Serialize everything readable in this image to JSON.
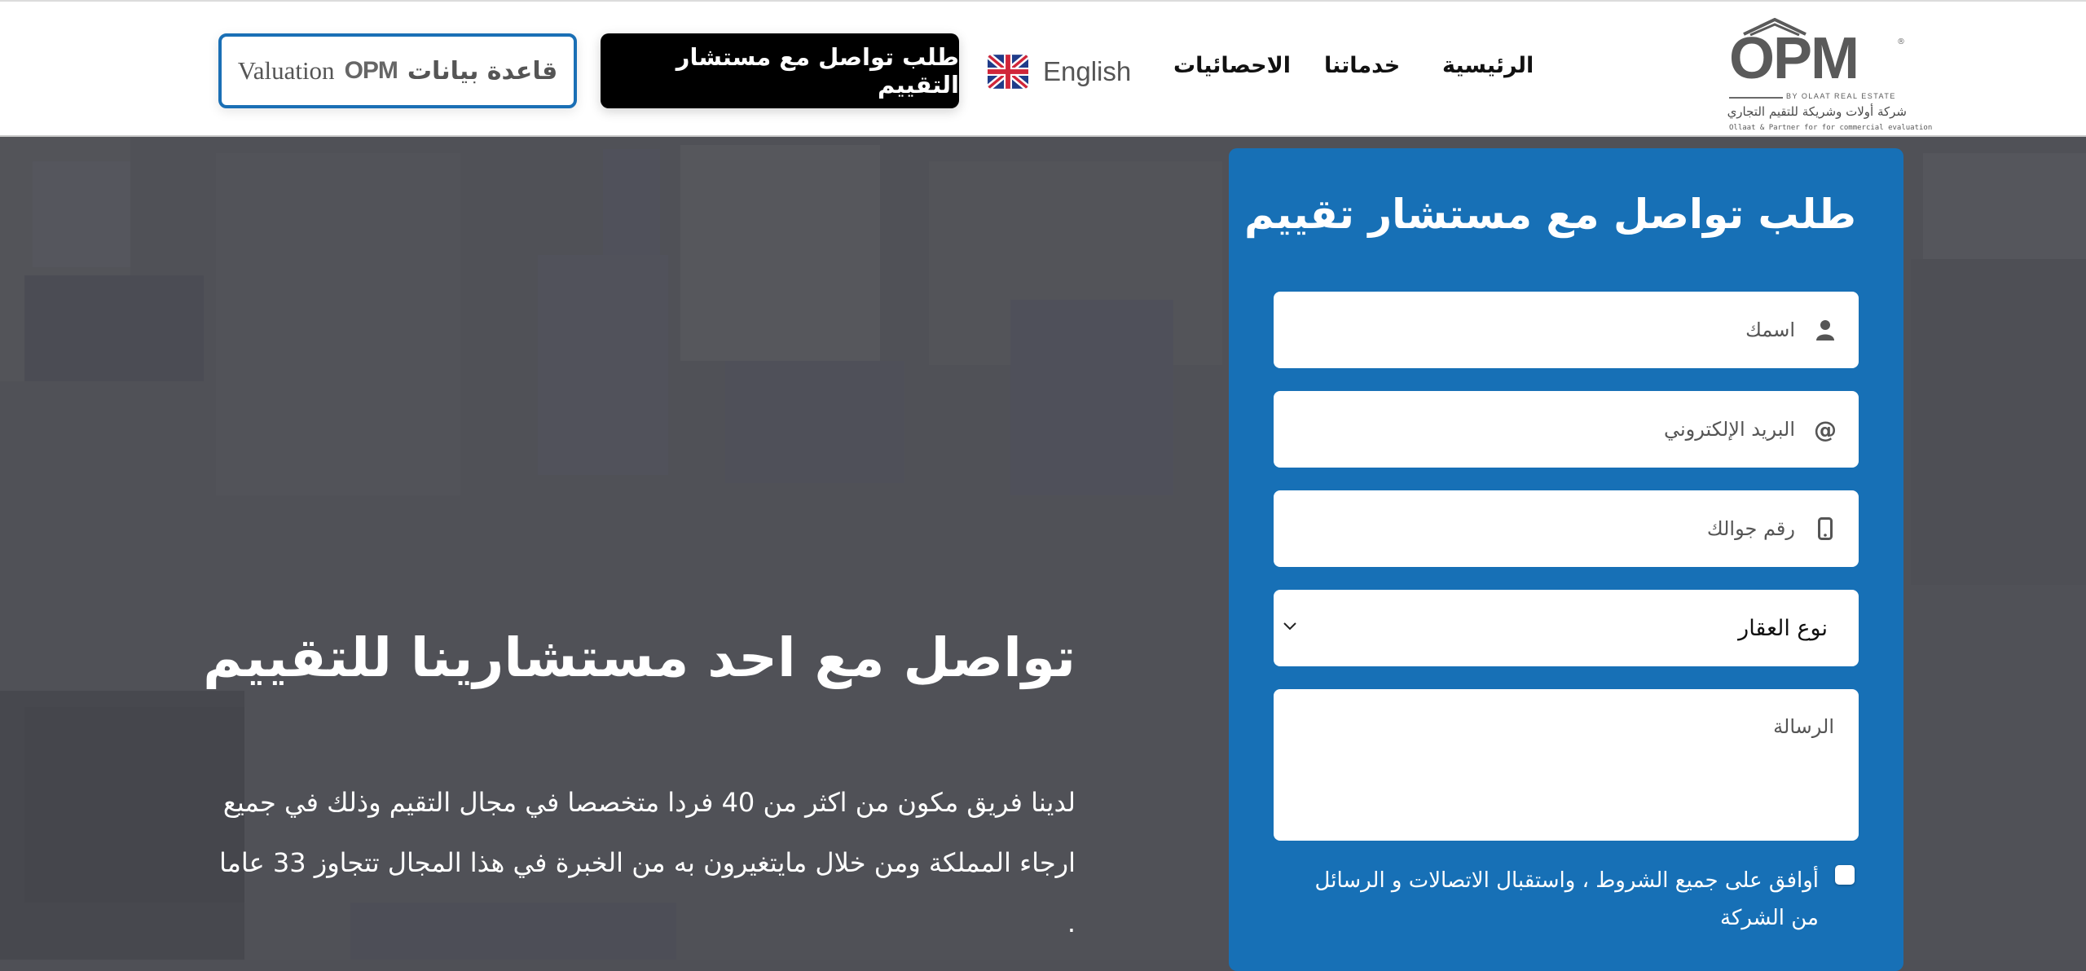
{
  "header": {
    "logo": {
      "mark": "OPM",
      "byline": "BY OLAAT REAL ESTATE",
      "arabic_name": "شركة أولات وشريكة للتقيم التجاري",
      "english_name": "Ollaat & Partner for for commercial evaluation"
    },
    "nav": [
      {
        "label": "الرئيسية"
      },
      {
        "label": "خدماتنا"
      },
      {
        "label": "الاحصائيات"
      }
    ],
    "language": {
      "label": "English",
      "icon": "uk-flag-icon"
    },
    "consult_button": "طلب تواصل مع مستشار التقييم",
    "database_button": {
      "arabic": "قاعدة بيانات",
      "brand": "OPM",
      "english": "Valuation"
    }
  },
  "hero": {
    "title": "تواصل مع احد مستشارينا للتقييم",
    "paragraph": "لدينا فريق مكون من اكثر من 40 فردا متخصصا في مجال التقيم وذلك في جميع ارجاء المملكة ومن خلال مايتغيرون به من الخبرة في هذا المجال تتجاوز 33 عاما ."
  },
  "form": {
    "title": "طلب تواصل مع مستشار تقييم",
    "name_placeholder": "اسمك",
    "email_placeholder": "البريد الإلكتروني",
    "phone_placeholder": "رقم جوالك",
    "property_type": {
      "selected": "نوع العقار"
    },
    "message_placeholder": "الرسالة",
    "agree_label": "أوافق على جميع الشروط ، واستقبال الاتصالات و الرسائل من الشركة",
    "agree_checked": false
  },
  "colors": {
    "panel_blue": "#1770b6",
    "db_border": "#1a6fb5",
    "hero_bg": "#505157"
  }
}
